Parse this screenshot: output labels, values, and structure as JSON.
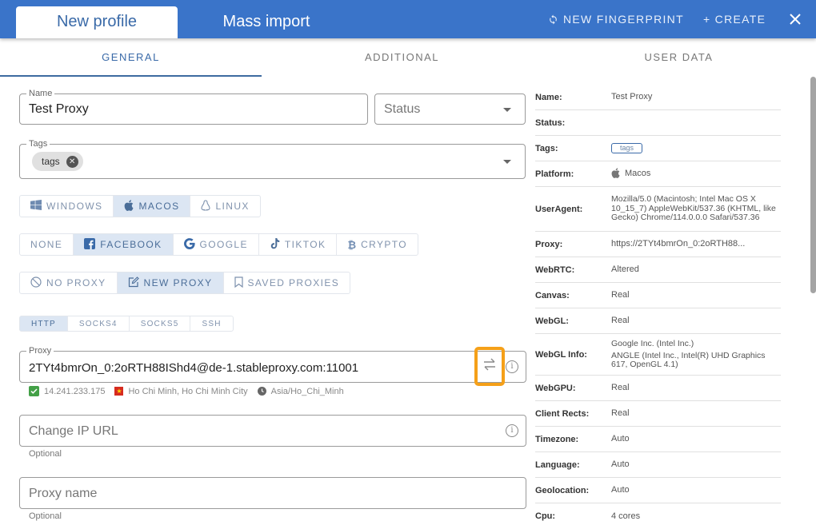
{
  "header": {
    "tabs": [
      {
        "label": "New profile",
        "active": true
      },
      {
        "label": "Mass import",
        "active": false
      }
    ],
    "new_fingerprint_label": "NEW FINGERPRINT",
    "create_label": "+ CREATE",
    "close_icon": "close-icon",
    "background_color": "#3a74c9"
  },
  "section_tabs": [
    {
      "label": "GENERAL",
      "active": true
    },
    {
      "label": "ADDITIONAL",
      "active": false
    },
    {
      "label": "USER DATA",
      "active": false
    }
  ],
  "form": {
    "name": {
      "label": "Name",
      "value": "Test Proxy"
    },
    "status": {
      "placeholder": "Status",
      "value": ""
    },
    "tags": {
      "label": "Tags",
      "chips": [
        "tags"
      ]
    },
    "platform": {
      "options": [
        {
          "label": "WINDOWS",
          "icon": "windows-icon",
          "active": false
        },
        {
          "label": "MACOS",
          "icon": "apple-icon",
          "active": true
        },
        {
          "label": "LINUX",
          "icon": "linux-icon",
          "active": false
        }
      ]
    },
    "template": {
      "options": [
        {
          "label": "NONE",
          "icon": "",
          "active": false
        },
        {
          "label": "FACEBOOK",
          "icon": "facebook-icon",
          "active": true
        },
        {
          "label": "GOOGLE",
          "icon": "google-icon",
          "active": false
        },
        {
          "label": "TIKTOK",
          "icon": "tiktok-icon",
          "active": false
        },
        {
          "label": "CRYPTO",
          "icon": "bitcoin-icon",
          "active": false
        }
      ]
    },
    "proxy_mode": {
      "options": [
        {
          "label": "NO PROXY",
          "icon": "block-icon",
          "active": false
        },
        {
          "label": "NEW PROXY",
          "icon": "edit-icon",
          "active": true
        },
        {
          "label": "SAVED PROXIES",
          "icon": "bookmark-icon",
          "active": false
        }
      ]
    },
    "proxy_type": {
      "options": [
        {
          "label": "HTTP",
          "active": true
        },
        {
          "label": "SOCKS4",
          "active": false
        },
        {
          "label": "SOCKS5",
          "active": false
        },
        {
          "label": "SSH",
          "active": false
        }
      ]
    },
    "proxy": {
      "label": "Proxy",
      "value": "2TYt4bmrOn_0:2oRTH88IShd4@de-1.stableproxy.com:11001",
      "ip": "14.241.233.175",
      "location": "Ho Chi Minh, Ho Chi Minh City",
      "timezone": "Asia/Ho_Chi_Minh",
      "highlight_color": "#f5a019"
    },
    "change_ip_url": {
      "placeholder": "Change IP URL",
      "hint": "Optional"
    },
    "proxy_name": {
      "placeholder": "Proxy name",
      "hint": "Optional"
    }
  },
  "summary": [
    {
      "key": "Name:",
      "value": "Test Proxy"
    },
    {
      "key": "Status:",
      "value": ""
    },
    {
      "key": "Tags:",
      "value": "tags"
    },
    {
      "key": "Platform:",
      "value": "Macos"
    },
    {
      "key": "UserAgent:",
      "value": "Mozilla/5.0 (Macintosh; Intel Mac OS X 10_15_7) AppleWebKit/537.36 (KHTML, like Gecko) Chrome/114.0.0.0 Safari/537.36"
    },
    {
      "key": "Proxy:",
      "value": "https://2TYt4bmrOn_0:2oRTH88..."
    },
    {
      "key": "WebRTC:",
      "value": "Altered"
    },
    {
      "key": "Canvas:",
      "value": "Real"
    },
    {
      "key": "WebGL:",
      "value": "Real"
    },
    {
      "key": "WebGL Info:",
      "value": "Google Inc. (Intel Inc.)",
      "value2": "ANGLE (Intel Inc., Intel(R) UHD Graphics 617, OpenGL 4.1)"
    },
    {
      "key": "WebGPU:",
      "value": "Real"
    },
    {
      "key": "Client Rects:",
      "value": "Real"
    },
    {
      "key": "Timezone:",
      "value": "Auto"
    },
    {
      "key": "Language:",
      "value": "Auto"
    },
    {
      "key": "Geolocation:",
      "value": "Auto"
    },
    {
      "key": "Cpu:",
      "value": "4 cores"
    }
  ]
}
